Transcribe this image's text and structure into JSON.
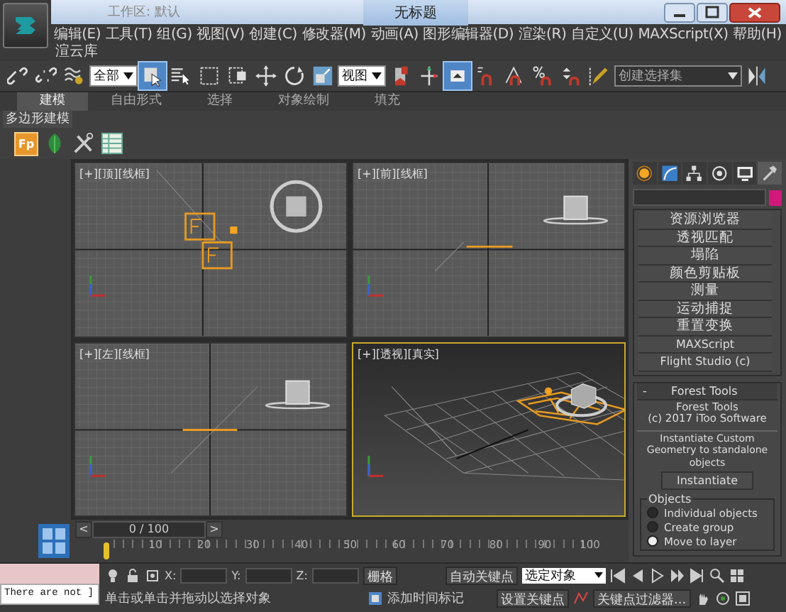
{
  "title_bar": {
    "workspace": "工作区: 默认",
    "title": "无标题"
  },
  "menu": [
    {
      "label": "编辑(E)"
    },
    {
      "label": "工具(T)"
    },
    {
      "label": "组(G)"
    },
    {
      "label": "视图(V)"
    },
    {
      "label": "创建(C)"
    },
    {
      "label": "修改器(M)"
    },
    {
      "label": "动画(A)"
    },
    {
      "label": "图形编辑器(D)"
    },
    {
      "label": "渲染(R)"
    },
    {
      "label": "自定义(U)"
    },
    {
      "label": "MAXScript(X)"
    },
    {
      "label": "帮助(H)"
    }
  ],
  "plugin_menu": "渲云库",
  "toolbar": [
    {
      "kind": "link",
      "selected": false
    },
    {
      "kind": "unlink",
      "selected": false
    },
    {
      "kind": "bind",
      "selected": false
    },
    {
      "kind": "dropdown",
      "value": "全部"
    },
    {
      "kind": "select",
      "selected": true
    },
    {
      "kind": "select-list",
      "selected": false
    },
    {
      "kind": "region",
      "selected": false
    },
    {
      "kind": "window",
      "selected": false
    },
    {
      "kind": "move",
      "selected": false
    },
    {
      "kind": "rotate",
      "selected": false
    },
    {
      "kind": "scale",
      "selected": false
    },
    {
      "kind": "dropdown",
      "value": "视图"
    },
    {
      "kind": "pivot",
      "selected": false
    },
    {
      "kind": "gizmo",
      "selected": false
    },
    {
      "kind": "override",
      "selected": true
    },
    {
      "kind": "snap",
      "selected": false
    },
    {
      "kind": "angle-snap",
      "selected": false
    },
    {
      "kind": "percent-snap",
      "selected": false
    },
    {
      "kind": "spinner-snap",
      "selected": false
    },
    {
      "kind": "pencil",
      "selected": false
    },
    {
      "kind": "dropdown",
      "value": "创建选择集"
    },
    {
      "kind": "mirror",
      "selected": false
    }
  ],
  "ribbon_tabs": [
    {
      "label": "建模",
      "selected": true
    },
    {
      "label": "自由形式",
      "selected": false
    },
    {
      "label": "选择",
      "selected": false
    },
    {
      "label": "对象绘制",
      "selected": false
    },
    {
      "label": "填充",
      "selected": false
    }
  ],
  "ribbon_panel": "多边形建模",
  "panel_tools": [
    {
      "kind": "badge",
      "label": "Fp"
    },
    {
      "kind": "leaf"
    },
    {
      "kind": "tools"
    },
    {
      "kind": "table"
    }
  ],
  "viewports": [
    {
      "label": "[+][顶][线框]",
      "kind": "top",
      "active": false
    },
    {
      "label": "[+][前][线框]",
      "kind": "front",
      "active": false
    },
    {
      "label": "[+][左][线框]",
      "kind": "left",
      "active": false
    },
    {
      "label": "[+][透视][真实]",
      "kind": "perspective",
      "active": true
    }
  ],
  "command_panel": {
    "tabs": [
      {
        "kind": "create",
        "selected": false
      },
      {
        "kind": "modify",
        "selected": false
      },
      {
        "kind": "hierarchy",
        "selected": false
      },
      {
        "kind": "motion",
        "selected": false
      },
      {
        "kind": "display",
        "selected": false
      },
      {
        "kind": "utilities",
        "selected": true
      }
    ],
    "color": "#d0197a",
    "buttons": [
      "资源浏览器",
      "透视匹配",
      "塌陷",
      "颜色剪贴板",
      "测量",
      "运动捕捉",
      "重置变换",
      "MAXScript",
      "Flight Studio (c)"
    ],
    "rollout": {
      "toggle": "-",
      "title": "Forest Tools",
      "info": "Forest Tools\n(c) 2017 iToo Software",
      "description": "Instantiate Custom Geometry to standalone objects",
      "button": "Instantiate",
      "group": "Objects",
      "options": [
        {
          "label": "Individual objects",
          "selected": false
        },
        {
          "label": "Create group",
          "selected": false
        },
        {
          "label": "Move to layer",
          "selected": true
        }
      ]
    }
  },
  "timeline": {
    "previous": "<",
    "frame": "0 / 100",
    "level": 0,
    "next": ">",
    "ticks": [
      "10",
      "20",
      "30",
      "40",
      "50",
      "60",
      "70",
      "80",
      "90",
      "100"
    ]
  },
  "status": {
    "script_output": "There are not ]",
    "x_label": "X:",
    "y_label": "Y:",
    "z_label": "Z:",
    "grid": "栅格",
    "auto_key": "自动关键点",
    "key_mode": "选定对象",
    "set_key": "设置关键点",
    "key_filters": "关键点过滤器...",
    "prompt": "单击或单击并拖动以选择对象",
    "time_tag": "添加时间标记"
  }
}
